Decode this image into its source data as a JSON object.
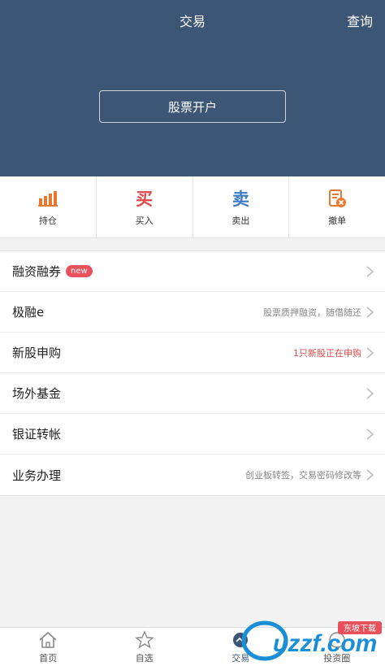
{
  "header": {
    "title": "交易",
    "query_label": "查询",
    "open_account_label": "股票开户",
    "bg_color": "#3e5676"
  },
  "actions": [
    {
      "label": "持仓",
      "icon": "bar-chart-icon",
      "color": "#e8782f"
    },
    {
      "label": "买入",
      "glyph": "买",
      "color": "#e04848"
    },
    {
      "label": "卖出",
      "glyph": "卖",
      "color": "#3a7bc8"
    },
    {
      "label": "撤单",
      "icon": "cancel-order-icon",
      "color": "#e8782f"
    }
  ],
  "menu": [
    {
      "label": "融资融券",
      "badge": "new",
      "hint": ""
    },
    {
      "label": "极融e",
      "hint": "股票质押融资，随借随还"
    },
    {
      "label": "新股申购",
      "hint": "1只新股正在申购",
      "hint_color": "#e04848"
    },
    {
      "label": "场外基金",
      "hint": ""
    },
    {
      "label": "银证转帐",
      "hint": ""
    },
    {
      "label": "业务办理",
      "hint": "创业板转签，交易密码修改等"
    }
  ],
  "tabs": [
    {
      "label": "首页",
      "icon": "home-icon"
    },
    {
      "label": "自选",
      "icon": "star-icon"
    },
    {
      "label": "交易",
      "icon": "trade-icon",
      "active": true
    },
    {
      "label": "投资圈",
      "icon": "circle-icon"
    }
  ],
  "watermark": {
    "text": "uzzf.com",
    "badge": "东坡下载"
  }
}
